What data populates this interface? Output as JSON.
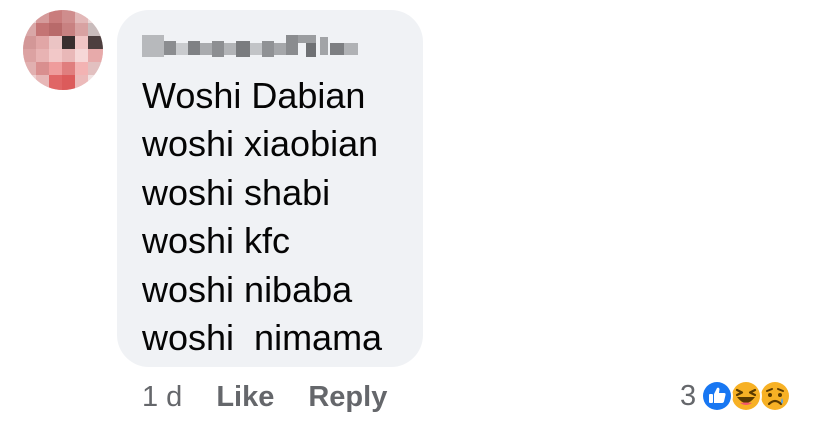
{
  "comment": {
    "author_name": "Ouyang Yin",
    "lines": [
      "Woshi Dabian",
      "woshi xiaobian",
      "woshi shabi",
      "woshi kfc",
      "woshi nibaba",
      "woshi  nimama"
    ],
    "timestamp": "1 d",
    "like_label": "Like",
    "reply_label": "Reply",
    "reaction_count": "3",
    "reactions": [
      "like-icon",
      "haha-icon",
      "sad-icon"
    ]
  },
  "colors": {
    "bubble": "#f0f2f5",
    "text": "#050505",
    "secondary_text": "#65676b",
    "like_blue": "#1877f2",
    "reaction_yellow": "#f7b125"
  }
}
